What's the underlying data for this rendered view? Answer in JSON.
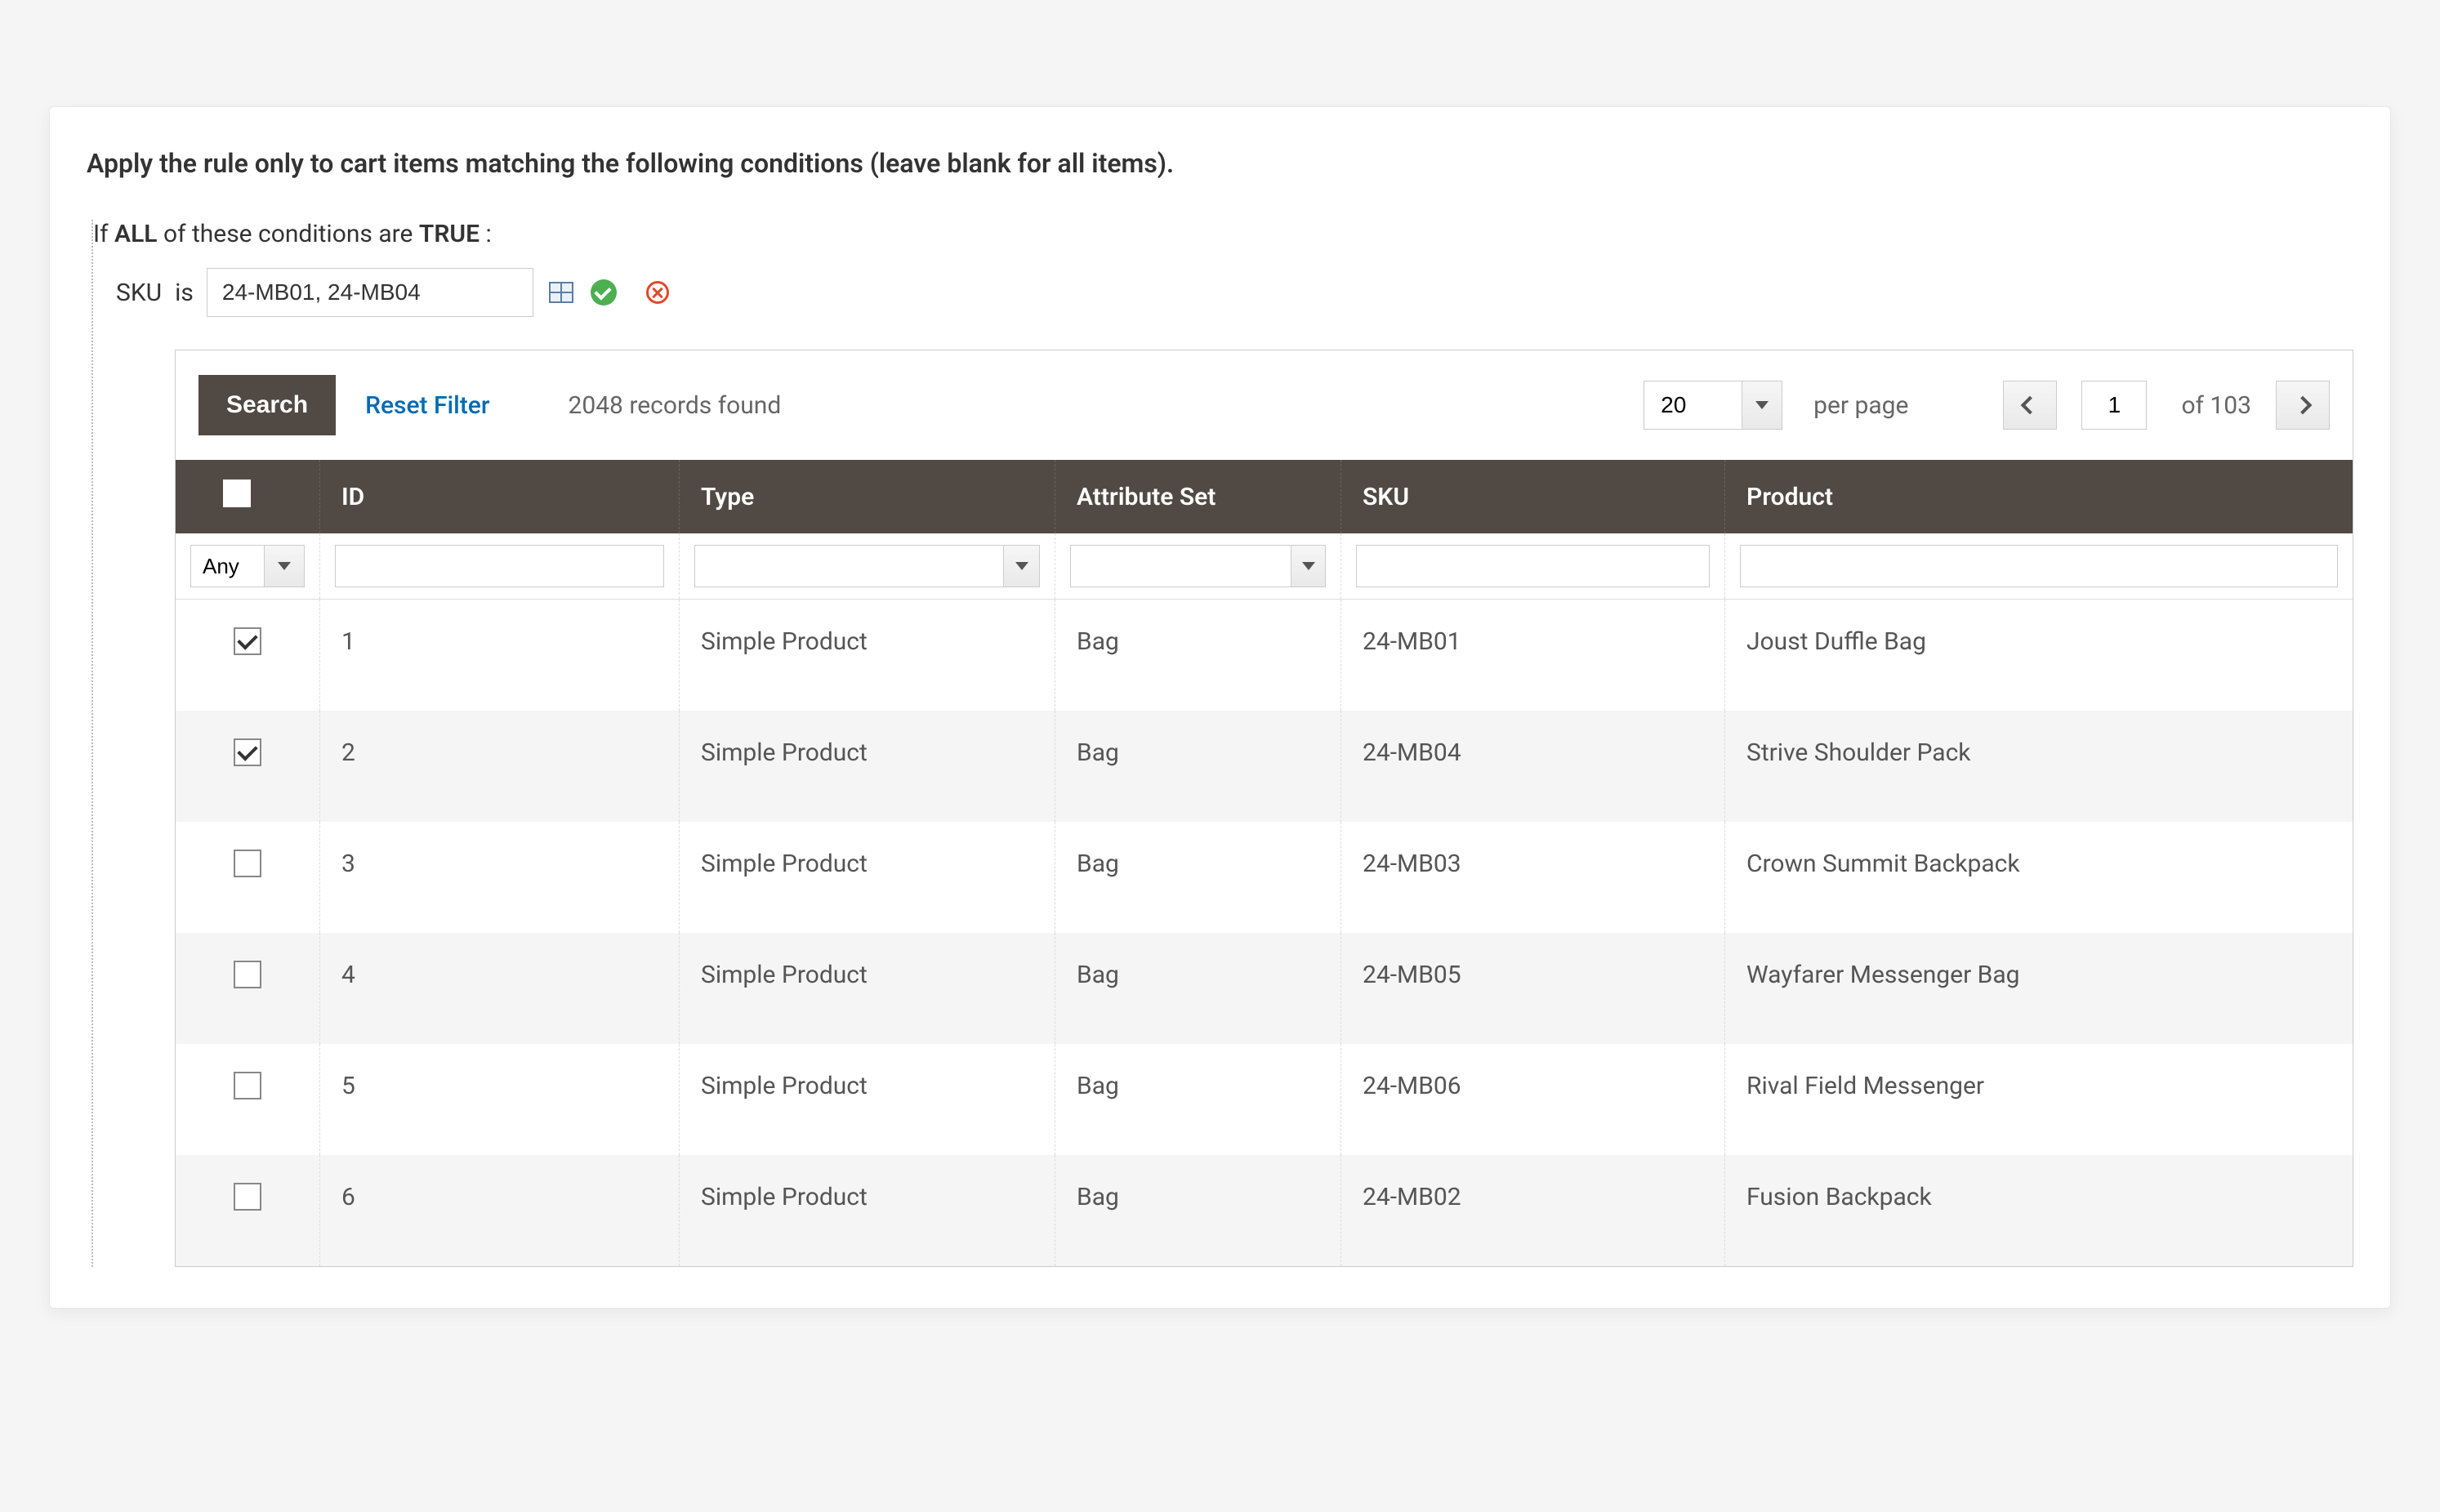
{
  "header": {
    "title": "Apply the rule only to cart items matching the following conditions (leave blank for all items).",
    "if_prefix": "If",
    "if_all": "ALL",
    "if_mid": "of these conditions are",
    "if_true": "TRUE",
    "if_colon": ":",
    "sku_label": "SKU",
    "sku_is": "is",
    "sku_value": "24-MB01, 24-MB04"
  },
  "toolbar": {
    "search": "Search",
    "reset": "Reset Filter",
    "records_found": "2048 records found",
    "per_page_value": "20",
    "per_page_label": "per page",
    "page_value": "1",
    "of_pages": "of 103"
  },
  "columns": {
    "id": "ID",
    "type": "Type",
    "attr": "Attribute Set",
    "sku": "SKU",
    "product": "Product"
  },
  "filters": {
    "any": "Any"
  },
  "rows": [
    {
      "checked": true,
      "id": "1",
      "type": "Simple Product",
      "attr": "Bag",
      "sku": "24-MB01",
      "product": "Joust Duffle Bag"
    },
    {
      "checked": true,
      "id": "2",
      "type": "Simple Product",
      "attr": "Bag",
      "sku": "24-MB04",
      "product": "Strive Shoulder Pack"
    },
    {
      "checked": false,
      "id": "3",
      "type": "Simple Product",
      "attr": "Bag",
      "sku": "24-MB03",
      "product": "Crown Summit Backpack"
    },
    {
      "checked": false,
      "id": "4",
      "type": "Simple Product",
      "attr": "Bag",
      "sku": "24-MB05",
      "product": "Wayfarer Messenger Bag"
    },
    {
      "checked": false,
      "id": "5",
      "type": "Simple Product",
      "attr": "Bag",
      "sku": "24-MB06",
      "product": "Rival Field Messenger"
    },
    {
      "checked": false,
      "id": "6",
      "type": "Simple Product",
      "attr": "Bag",
      "sku": "24-MB02",
      "product": "Fusion Backpack"
    }
  ]
}
